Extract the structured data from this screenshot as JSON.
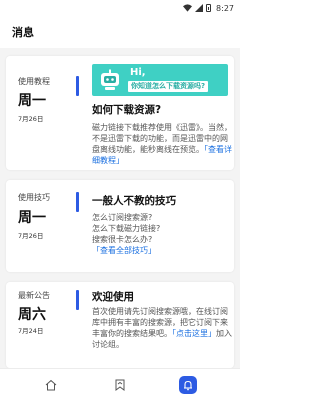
{
  "status_bar": {
    "time": "8:27"
  },
  "header": {
    "title": "消息"
  },
  "cards": [
    {
      "category": "使用教程",
      "day": "周一",
      "date": "7月26日",
      "banner": {
        "greeting": "Hi,",
        "question": "你知道怎么下载资源吗?"
      },
      "title": "如何下载资源?",
      "body": "磁力链接下载推荐使用《迅雷》。当然，不是迅雷下载的功能，而是迅雷中的网盘离线功能，能秒离线在预览。",
      "link": "「查看详细教程」"
    },
    {
      "category": "使用技巧",
      "day": "周一",
      "date": "7月26日",
      "title": "一般人不教的技巧",
      "body_lines": [
        "怎么订阅搜索源?",
        "怎么下载磁力链接?",
        "搜索很卡怎么办?"
      ],
      "link": "「查看全部技巧」"
    },
    {
      "category": "最新公告",
      "day": "周六",
      "date": "7月24日",
      "title": "欢迎使用",
      "body": "首次使用请先订阅搜索源哦，在线订阅库中拥有丰富的搜索源，把它订阅下来丰富你的搜索结果吧。",
      "link": "「点击这里」",
      "body_suffix": "加入讨论组。"
    }
  ],
  "nav": {
    "items": [
      {
        "icon": "home-icon"
      },
      {
        "icon": "bookmark-icon"
      },
      {
        "icon": "message-icon",
        "active": true
      }
    ]
  },
  "colors": {
    "accent": "#2d5be3",
    "link": "#1a6fe0",
    "banner": "#3fd0c4"
  }
}
